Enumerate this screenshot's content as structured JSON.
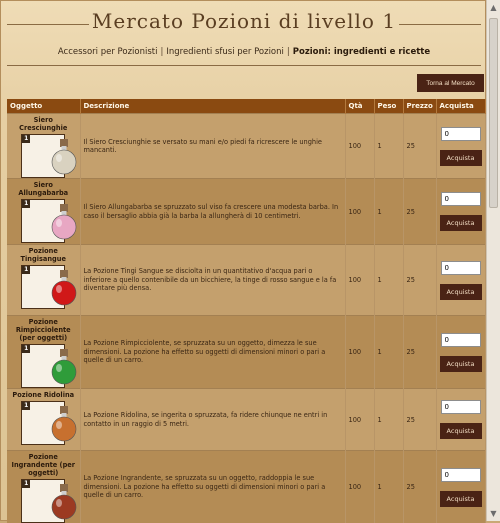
{
  "page": {
    "title": "Mercato Pozioni di livello 1"
  },
  "nav": {
    "links": [
      {
        "label": "Accessori per Pozionisti"
      },
      {
        "label": "Ingredienti sfusi per Pozioni"
      },
      {
        "label": "Pozioni: ingredienti e ricette"
      }
    ],
    "separator": "|"
  },
  "back_button": {
    "label": "Torna al Mercato"
  },
  "table": {
    "headers": {
      "item": "Oggetto",
      "description": "Descrizione",
      "qty": "Qtà",
      "weight": "Peso",
      "price": "Prezzo",
      "buy": "Acquista"
    },
    "rows": [
      {
        "name": "Siero Cresciunghie",
        "badge": "1",
        "description": "Il Siero Cresciunghie se versato su mani e/o piedi fa ricrescere le unghie mancanti.",
        "qty": "100",
        "weight": "1",
        "price": "25",
        "input_value": "0",
        "buy_label": "Acquista",
        "bottle_color": "#d9d2c0"
      },
      {
        "name": "Siero Allungabarba",
        "badge": "1",
        "description": "Il Siero Allungabarba se spruzzato sul viso fa crescere una modesta barba. In caso il bersaglio abbia già la barba la allungherà di 10 centimetri.",
        "qty": "100",
        "weight": "1",
        "price": "25",
        "input_value": "0",
        "buy_label": "Acquista",
        "bottle_color": "#e8a7c3"
      },
      {
        "name": "Pozione Tingisangue",
        "badge": "1",
        "description": "La Pozione Tingi Sangue se disciolta in un quantitativo d'acqua pari o inferiore a quello contenibile da un bicchiere, la tinge di rosso sangue e la fa diventare più densa.",
        "qty": "100",
        "weight": "1",
        "price": "25",
        "input_value": "0",
        "buy_label": "Acquista",
        "bottle_color": "#d01818"
      },
      {
        "name": "Pozione Rimpicciolente (per oggetti)",
        "badge": "1",
        "description": "La Pozione Rimpicciolente, se spruzzata su un oggetto, dimezza le sue dimensioni. La pozione ha effetto su oggetti di dimensioni minori o pari a quelle di un carro.",
        "qty": "100",
        "weight": "1",
        "price": "25",
        "input_value": "0",
        "buy_label": "Acquista",
        "bottle_color": "#2f9c3a"
      },
      {
        "name": "Pozione Ridolina",
        "badge": "1",
        "description": "La Pozione Ridolina, se ingerita o spruzzata, fa ridere chiunque ne entri in contatto in un raggio di 5 metri.",
        "qty": "100",
        "weight": "1",
        "price": "25",
        "input_value": "0",
        "buy_label": "Acquista",
        "bottle_color": "#c7702f"
      },
      {
        "name": "Pozione Ingrandente (per oggetti)",
        "badge": "1",
        "description": "La Pozione Ingrandente, se spruzzata su un oggetto, raddoppia le sue dimensioni. La pozione ha effetto su oggetti di dimensioni minori o pari a quelle di un carro.",
        "qty": "100",
        "weight": "1",
        "price": "25",
        "input_value": "0",
        "buy_label": "Acquista",
        "bottle_color": "#9c3a22"
      }
    ]
  },
  "colors": {
    "header_bg": "#8a4a11",
    "button_bg": "#4a2315",
    "row_light": "#c4a06d",
    "row_dark": "#b48c55"
  }
}
